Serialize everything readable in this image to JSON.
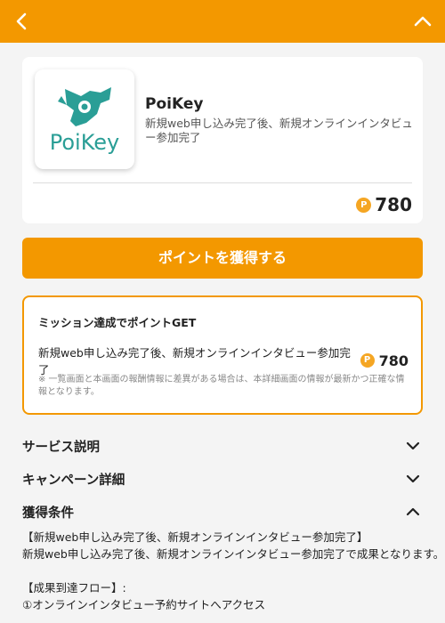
{
  "header": {
    "back_icon": "chevron-left-icon",
    "collapse_icon": "chevron-up-icon",
    "color": "#f39800"
  },
  "app": {
    "logo_text": "PoiKey",
    "name": "PoiKey",
    "description": "新規web申し込み完了後、新規オンラインインタビュー参加完了",
    "points": "780"
  },
  "cta": {
    "label": "ポイントを獲得する"
  },
  "mission": {
    "title": "ミッション達成でポイントGET",
    "item_label": "新規web申し込み完了後、新規オンラインインタビュー参加完了",
    "item_points": "780",
    "note": "※ 一覧画面と本画面の報酬情報に差異がある場合は、本詳細画面の情報が最新かつ正確な情報となります。"
  },
  "sections": {
    "service": "サービス説明",
    "campaign": "キャンペーン詳細",
    "conditions": "獲得条件"
  },
  "conditions_body": {
    "line1": "【新規web申し込み完了後、新規オンラインインタビュー参加完了】",
    "line2": "新規web申し込み完了後、新規オンラインインタビュー参加完了で成果となります。",
    "line3": "【成果到達フロー】:",
    "line4": "①オンラインインタビュー予約サイトへアクセス"
  },
  "coin_symbol": "P",
  "accent": "#f39800",
  "coin_color": "#f5a623"
}
